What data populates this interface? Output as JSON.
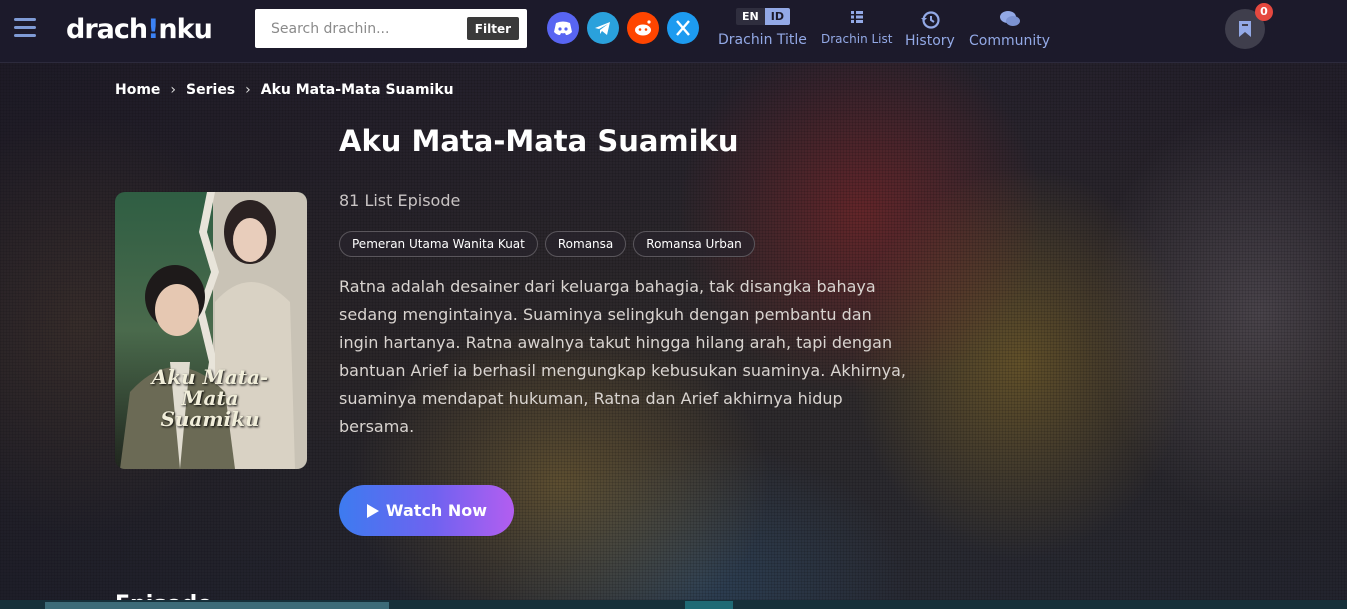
{
  "header": {
    "logo_text": "drach",
    "logo_text_mark": "!",
    "logo_text_end": "nku",
    "search_placeholder": "Search drachin...",
    "filter_label": "Filter",
    "social": [
      "discord-icon",
      "telegram-icon",
      "reddit-icon",
      "x-icon"
    ],
    "social_colors": [
      "#5865f2",
      "#2aa1dc",
      "#ff4500",
      "#1d9bf0"
    ],
    "lang": {
      "en": "EN",
      "id": "ID",
      "selected": "ID"
    },
    "nav": {
      "drachin_title": "Drachin Title",
      "drachin_list": "Drachin List",
      "history": "History",
      "community": "Community"
    },
    "bookmark_count": "0"
  },
  "breadcrumb": {
    "home": "Home",
    "series": "Series",
    "current": "Aku Mata-Mata Suamiku",
    "separator": "›"
  },
  "series": {
    "title": "Aku Mata-Mata Suamiku",
    "poster_caption": "Aku Mata-Mata Suamiku",
    "episode_count": "81 List Episode",
    "tags": [
      "Pemeran Utama Wanita Kuat",
      "Romansa",
      "Romansa Urban"
    ],
    "synopsis": "Ratna adalah desainer dari keluarga bahagia, tak disangka bahaya sedang mengintainya. Suaminya selingkuh dengan pembantu dan ingin hartanya. Ratna awalnya takut hingga hilang arah, tapi dengan bantuan Arief ia berhasil mengungkap kebusukan suaminya. Akhirnya, suaminya mendapat hukuman, Ratna dan Arief akhirnya hidup bersama.",
    "watch_label": "Watch Now"
  },
  "episodes_heading": "Episode",
  "colors": {
    "accent": "#93a9e6",
    "header_bg": "#1c1a2b",
    "watch_gradient_start": "#3d7bf0",
    "watch_gradient_end": "#b35ef0",
    "badge": "#e5483f"
  }
}
